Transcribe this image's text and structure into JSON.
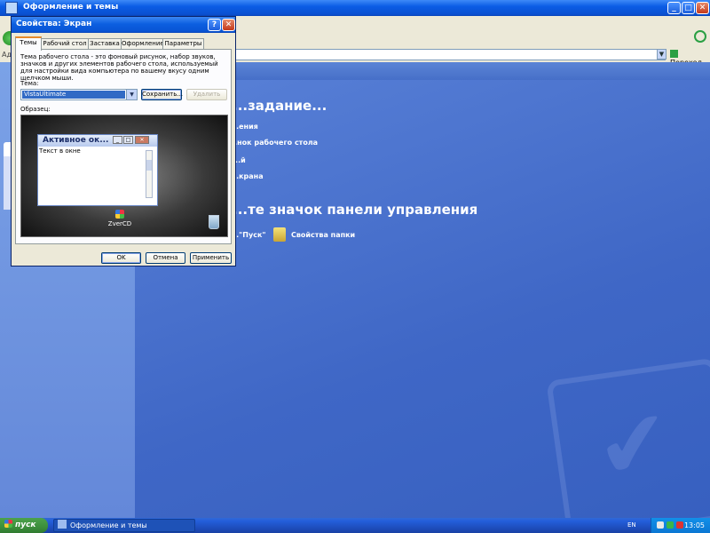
{
  "bg_window": {
    "title": "Оформление и темы",
    "address_label": "Ад",
    "go_label": "Переход",
    "headings": [
      "...задание...",
      "...те значок панели управления"
    ],
    "links": [
      "...ения",
      "...нок рабочего стола",
      "...й",
      "...крана",
      "...\"Пуск\"",
      "Свойства папки"
    ]
  },
  "dialog": {
    "title": "Свойства: Экран",
    "tabs": [
      "Темы",
      "Рабочий стол",
      "Заставка",
      "Оформление",
      "Параметры"
    ],
    "description": "Тема рабочего стола - это фоновый рисунок, набор звуков, значков и других элементов рабочего стола, используемый для настройки вида компьютера по вашему вкусу одним щелчком мыши.",
    "theme_label": "Тема:",
    "theme_value": "VistaUltimate",
    "save_button": "Сохранить...",
    "delete_button": "Удалить",
    "sample_label": "Образец:",
    "preview": {
      "window_title": "Активное ок...",
      "window_text": "Текст в окне",
      "logo_text": "ZverCD"
    },
    "ok_button": "OK",
    "cancel_button": "Отмена",
    "apply_button": "Применить"
  },
  "taskbar": {
    "start_label": "пуск",
    "task_item": "Оформление и темы",
    "lang": "EN",
    "clock": "13:05"
  }
}
